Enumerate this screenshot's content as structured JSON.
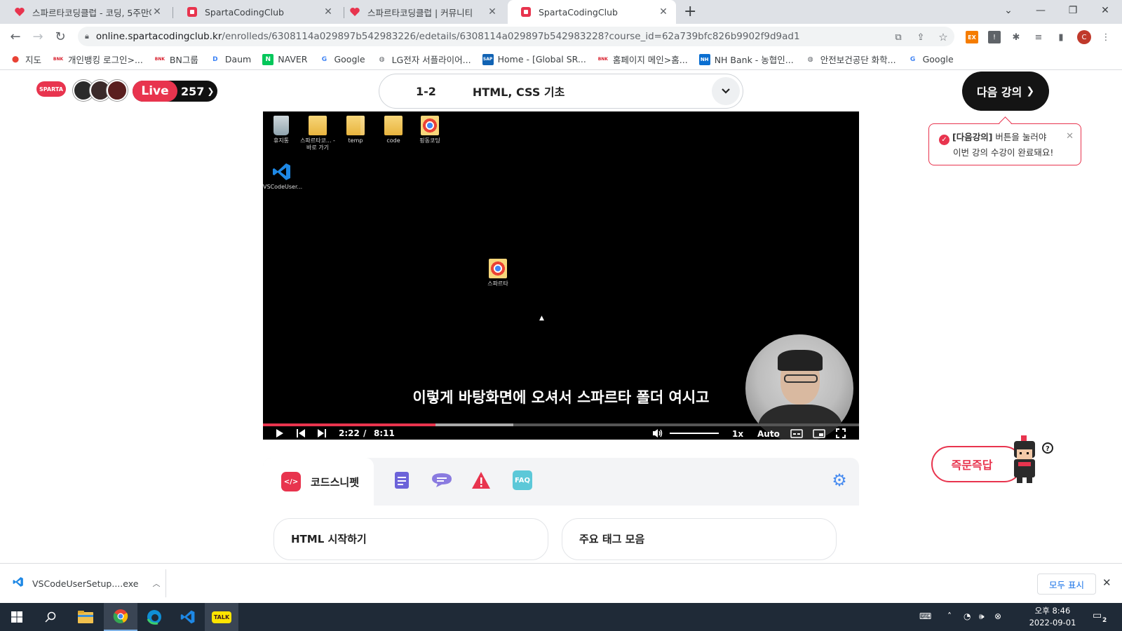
{
  "browser": {
    "tabs": [
      {
        "title": "스파르타코딩클럽 - 코딩, 5주만에",
        "active": false
      },
      {
        "title": "SpartaCodingClub",
        "active": false
      },
      {
        "title": "스파르타코딩클럽 | 커뮤니티",
        "active": false
      },
      {
        "title": "SpartaCodingClub",
        "active": true
      }
    ],
    "url_domain": "online.spartacodingclub.kr",
    "url_path": "/enrolleds/6308114a029897b542983226/edetails/6308114a029897b542983228?course_id=62a739bfc826b9902f9d9ad1",
    "profile_initial": "C",
    "ext_badge": "EX",
    "bookmarks": [
      {
        "label": "지도",
        "icon": "maps-pin-icon",
        "color": "#e94235"
      },
      {
        "label": "개인뱅킹 로그인>...",
        "icon": "bnk-icon",
        "color": "#d81e2c"
      },
      {
        "label": "BN그룹",
        "icon": "bn-icon",
        "color": "#d81e2c"
      },
      {
        "label": "Daum",
        "icon": "daum-icon",
        "color": "#3b82f6"
      },
      {
        "label": "NAVER",
        "icon": "naver-icon",
        "color": "#03c75a"
      },
      {
        "label": "Google",
        "icon": "google-icon",
        "color": "#4285f4"
      },
      {
        "label": "LG전자 서플라이어...",
        "icon": "globe-icon",
        "color": "#5f6368"
      },
      {
        "label": "Home - [Global SR...",
        "icon": "sap-icon",
        "color": "#1163b4"
      },
      {
        "label": "홈페이지 메인>홈...",
        "icon": "bnk-icon",
        "color": "#d81e2c"
      },
      {
        "label": "NH Bank - 농협인...",
        "icon": "nh-icon",
        "color": "#0b6fd1"
      },
      {
        "label": "안전보건공단 화학...",
        "icon": "globe-icon",
        "color": "#5f6368"
      },
      {
        "label": "Google",
        "icon": "google-icon",
        "color": "#4285f4"
      }
    ]
  },
  "page": {
    "logo": "SPARTA",
    "live_label": "Live",
    "live_count": "257",
    "lesson_number": "1-2",
    "lesson_title": "HTML, CSS 기초",
    "next_button": "다음 강의",
    "tooltip": {
      "bold": "[다음강의]",
      "line1_rest": " 버튼을 눌러야",
      "line2": "이번 강의 수강이 완료돼요!"
    },
    "video": {
      "desktop_icons": [
        {
          "label": "휴지통",
          "icon": "recycle-bin-icon"
        },
        {
          "label": "스파르타코... - 바로 가기",
          "icon": "folder-shortcut-icon"
        },
        {
          "label": "temp",
          "icon": "folder-icon"
        },
        {
          "label": "code",
          "icon": "folder-icon"
        },
        {
          "label": "핑동코딩",
          "icon": "chrome-file-icon"
        },
        {
          "label": "VSCodeUser...",
          "icon": "vscode-icon"
        },
        {
          "label": "스파르타",
          "icon": "chrome-file-icon"
        }
      ],
      "subtitle": "이렇게 바탕화면에 오셔서 스파르타 폴더 여시고",
      "current_time": "2:22",
      "time_separator": "/",
      "duration": "8:11",
      "played_fraction": 0.289,
      "buffered_fraction": 0.42,
      "speed": "1x",
      "quality": "Auto"
    },
    "panel": {
      "active_tab": "코드스니펫",
      "tabs": [
        {
          "icon": "notes-icon",
          "color": "#6c63d9"
        },
        {
          "icon": "chat-icon",
          "color": "#8a7be0"
        },
        {
          "icon": "warning-icon",
          "color": "#e8344e"
        },
        {
          "icon": "faq-icon",
          "color": "#5cc8d8",
          "label": "FAQ"
        }
      ],
      "cards": [
        "HTML 시작하기",
        "주요 태그 모음"
      ]
    },
    "qna_button": "즉문즉답"
  },
  "download_bar": {
    "file": "VSCodeUserSetup....exe",
    "show_all": "모두 표시"
  },
  "taskbar": {
    "clock_time": "오후 8:46",
    "clock_date": "2022-09-01",
    "notifications": "2"
  },
  "colors": {
    "brand": "#e8344e",
    "dark": "#141414"
  }
}
